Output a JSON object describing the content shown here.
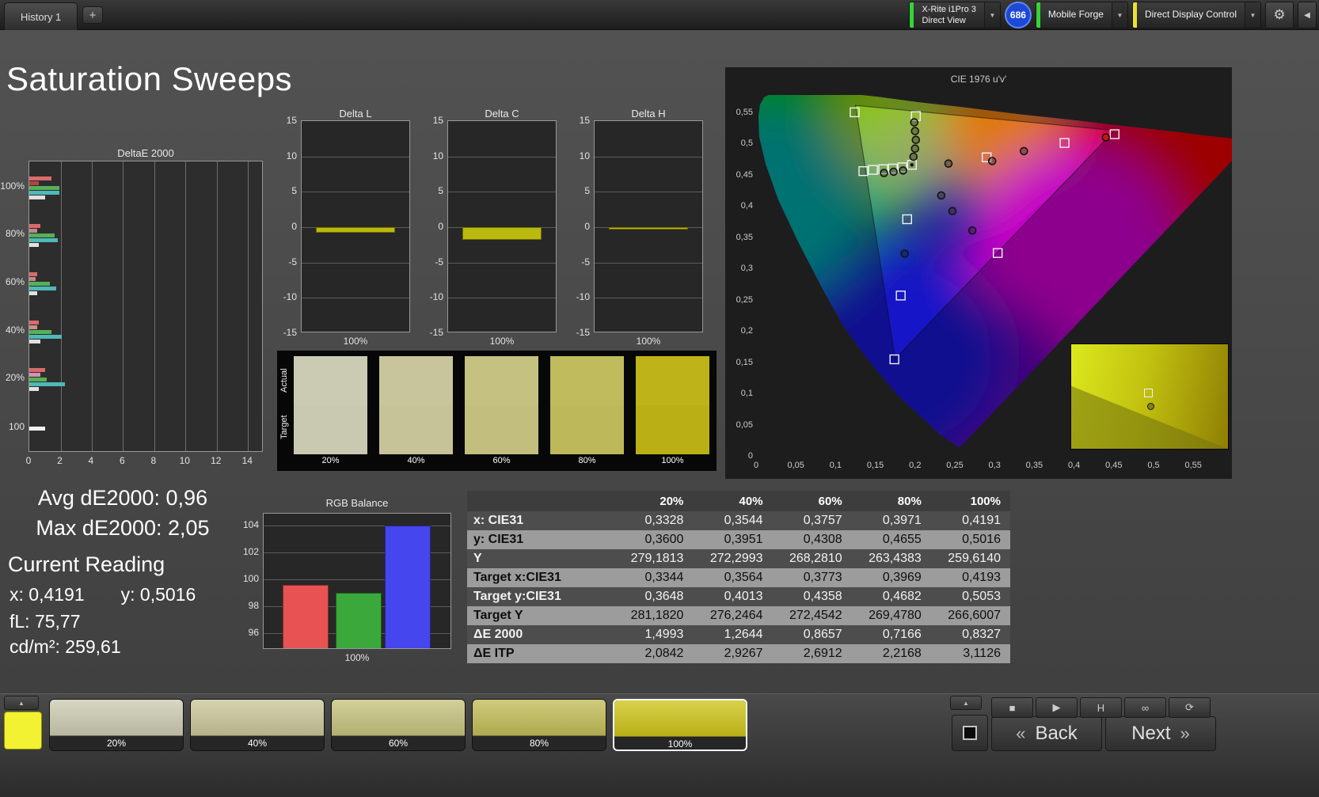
{
  "page_title": "Saturation Sweeps",
  "icons": {
    "gear": "⚙",
    "collapse": "◀",
    "chevron": "▼",
    "up": "▲",
    "back_chevron": "«",
    "next_chevron": "»"
  },
  "top_bar": {
    "history_tab": "History 1",
    "add_tab": "+",
    "meter": {
      "line1": "X-Rite i1Pro 3",
      "line2": "Direct View",
      "accent": "#35d435"
    },
    "badge": "686",
    "badge_color": "#1d49d8",
    "source": {
      "label": "Mobile Forge",
      "accent": "#35d435"
    },
    "display_control": {
      "label": "Direct Display Control",
      "accent": "#e8e136"
    }
  },
  "charts": {
    "deltae2000": {
      "title": "DeltaE 2000",
      "x_ticks": [
        "0",
        "2",
        "4",
        "6",
        "8",
        "10",
        "12",
        "14"
      ],
      "x_max": 15,
      "groups": [
        {
          "label": "100%",
          "bars": [
            {
              "color": "#d96b6b",
              "value": 1.4
            },
            {
              "color": "#b04545",
              "value": 0.6
            },
            {
              "color": "#57b057",
              "value": 1.9
            },
            {
              "color": "#4fb8b8",
              "value": 1.9
            },
            {
              "color": "#e0e0e0",
              "value": 1.0
            }
          ]
        },
        {
          "label": "80%",
          "bars": [
            {
              "color": "#d96b6b",
              "value": 0.7
            },
            {
              "color": "#c08888",
              "value": 0.5
            },
            {
              "color": "#57b057",
              "value": 1.6
            },
            {
              "color": "#4fb8b8",
              "value": 1.8
            },
            {
              "color": "#e0e0e0",
              "value": 0.6
            }
          ]
        },
        {
          "label": "60%",
          "bars": [
            {
              "color": "#d96b6b",
              "value": 0.5
            },
            {
              "color": "#c08888",
              "value": 0.4
            },
            {
              "color": "#57b057",
              "value": 1.3
            },
            {
              "color": "#4fb8b8",
              "value": 1.7
            },
            {
              "color": "#e0e0e0",
              "value": 0.5
            }
          ]
        },
        {
          "label": "40%",
          "bars": [
            {
              "color": "#d96b6b",
              "value": 0.6
            },
            {
              "color": "#c79090",
              "value": 0.5
            },
            {
              "color": "#57b057",
              "value": 1.4
            },
            {
              "color": "#4fb8b8",
              "value": 2.1
            },
            {
              "color": "#e0e0e0",
              "value": 0.7
            }
          ]
        },
        {
          "label": "20%",
          "bars": [
            {
              "color": "#d96b6b",
              "value": 1.0
            },
            {
              "color": "#d98fb0",
              "value": 0.7
            },
            {
              "color": "#57b057",
              "value": 1.1
            },
            {
              "color": "#4fb8b8",
              "value": 2.3
            },
            {
              "color": "#e0e0e0",
              "value": 0.6
            }
          ]
        },
        {
          "label": "100",
          "bars": [
            {
              "color": "#f0f0f0",
              "value": 1.0
            }
          ]
        }
      ]
    },
    "delta_l": {
      "title": "Delta L",
      "value": -0.8,
      "y_ticks": [
        "15",
        "10",
        "5",
        "0",
        "-5",
        "-10",
        "-15"
      ],
      "x_label": "100%",
      "bar_color": "#b9b90f"
    },
    "delta_c": {
      "title": "Delta C",
      "value": -1.8,
      "y_ticks": [
        "15",
        "10",
        "5",
        "0",
        "-5",
        "-10",
        "-15"
      ],
      "x_label": "100%",
      "bar_color": "#b9b90f"
    },
    "delta_h": {
      "title": "Delta H",
      "value": -0.35,
      "y_ticks": [
        "15",
        "10",
        "5",
        "0",
        "-5",
        "-10",
        "-15"
      ],
      "x_label": "100%",
      "bar_color": "#b9b90f"
    },
    "rgb_balance": {
      "title": "RGB Balance",
      "x_label": "100%",
      "y_ticks": [
        "104",
        "102",
        "100",
        "98",
        "96"
      ],
      "top_value": 104,
      "bars": [
        {
          "name": "red",
          "value": 99.6,
          "color": "#e85252"
        },
        {
          "name": "green",
          "value": 99.0,
          "color": "#3aa83a"
        },
        {
          "name": "blue",
          "value": 104.0,
          "color": "#4646ee"
        }
      ]
    }
  },
  "swatch_strip": {
    "row_labels": [
      "Actual",
      "Target"
    ],
    "levels": [
      "20%",
      "40%",
      "60%",
      "80%",
      "100%"
    ],
    "actual_colors": [
      "#cbcab3",
      "#c8c59c",
      "#c4c181",
      "#c0bb5d",
      "#beb419"
    ],
    "target_colors": [
      "#c9c8b0",
      "#c6c399",
      "#c2bf7e",
      "#bdb859",
      "#bab015"
    ]
  },
  "cie": {
    "title": "CIE 1976 u'v'",
    "x_ticks": [
      "0",
      "0,05",
      "0,1",
      "0,15",
      "0,2",
      "0,25",
      "0,3",
      "0,35",
      "0,4",
      "0,45",
      "0,5",
      "0,55"
    ],
    "y_ticks": [
      "0",
      "0,05",
      "0,1",
      "0,15",
      "0,2",
      "0,25",
      "0,3",
      "0,35",
      "0,4",
      "0,45",
      "0,5",
      "0,55"
    ],
    "locus": [
      [
        0.256,
        0.016
      ],
      [
        0.23,
        0.038
      ],
      [
        0.216,
        0.055
      ],
      [
        0.178,
        0.1
      ],
      [
        0.144,
        0.151
      ],
      [
        0.11,
        0.21
      ],
      [
        0.083,
        0.271
      ],
      [
        0.053,
        0.345
      ],
      [
        0.028,
        0.412
      ],
      [
        0.012,
        0.47
      ],
      [
        0.004,
        0.513
      ],
      [
        0.003,
        0.545
      ],
      [
        0.005,
        0.564
      ],
      [
        0.01,
        0.576
      ],
      [
        0.023,
        0.584
      ],
      [
        0.046,
        0.586
      ],
      [
        0.079,
        0.586
      ],
      [
        0.115,
        0.582
      ],
      [
        0.153,
        0.577
      ],
      [
        0.205,
        0.568
      ],
      [
        0.262,
        0.56
      ],
      [
        0.33,
        0.549
      ],
      [
        0.404,
        0.539
      ],
      [
        0.462,
        0.53
      ],
      [
        0.52,
        0.522
      ],
      [
        0.57,
        0.514
      ],
      [
        0.623,
        0.507
      ]
    ],
    "gamut_triangle": [
      [
        0.451,
        0.523
      ],
      [
        0.125,
        0.563
      ],
      [
        0.175,
        0.158
      ]
    ],
    "white_point": [
      0.196,
      0.468
    ],
    "targets": [
      [
        0.124,
        0.552
      ],
      [
        0.201,
        0.546
      ],
      [
        0.135,
        0.458
      ],
      [
        0.147,
        0.46
      ],
      [
        0.16,
        0.461
      ],
      [
        0.172,
        0.462
      ],
      [
        0.184,
        0.464
      ],
      [
        0.196,
        0.468
      ],
      [
        0.29,
        0.48
      ],
      [
        0.388,
        0.503
      ],
      [
        0.451,
        0.517
      ],
      [
        0.19,
        0.381
      ],
      [
        0.304,
        0.327
      ],
      [
        0.182,
        0.259
      ],
      [
        0.174,
        0.157
      ]
    ],
    "measurements": [
      {
        "u": 0.199,
        "v": 0.536
      },
      {
        "u": 0.2,
        "v": 0.522
      },
      {
        "u": 0.201,
        "v": 0.508
      },
      {
        "u": 0.2,
        "v": 0.494
      },
      {
        "u": 0.198,
        "v": 0.481
      },
      {
        "u": 0.161,
        "v": 0.455
      },
      {
        "u": 0.173,
        "v": 0.457
      },
      {
        "u": 0.185,
        "v": 0.459
      },
      {
        "u": 0.242,
        "v": 0.47
      },
      {
        "u": 0.297,
        "v": 0.474
      },
      {
        "u": 0.337,
        "v": 0.49
      },
      {
        "u": 0.44,
        "v": 0.512,
        "fill": "#cc1212"
      },
      {
        "u": 0.233,
        "v": 0.419
      },
      {
        "u": 0.247,
        "v": 0.394
      },
      {
        "u": 0.272,
        "v": 0.363
      },
      {
        "u": 0.187,
        "v": 0.326
      }
    ]
  },
  "readings": {
    "avg": "Avg dE2000: 0,96",
    "max": "Max dE2000: 2,05",
    "current_title": "Current Reading",
    "x": "x: 0,4191",
    "y": "y: 0,5016",
    "fl": "fL: 75,77",
    "cd": "cd/m²: 259,61"
  },
  "table": {
    "header": [
      "",
      "20%",
      "40%",
      "60%",
      "80%",
      "100%"
    ],
    "rows": [
      {
        "label": "x: CIE31",
        "values": [
          "0,3328",
          "0,3544",
          "0,3757",
          "0,3971",
          "0,4191"
        ]
      },
      {
        "label": "y: CIE31",
        "values": [
          "0,3600",
          "0,3951",
          "0,4308",
          "0,4655",
          "0,5016"
        ]
      },
      {
        "label": "Y",
        "values": [
          "279,1813",
          "272,2993",
          "268,2810",
          "263,4383",
          "259,6140"
        ]
      },
      {
        "label": "Target x:CIE31",
        "values": [
          "0,3344",
          "0,3564",
          "0,3773",
          "0,3969",
          "0,4193"
        ]
      },
      {
        "label": "Target y:CIE31",
        "values": [
          "0,3648",
          "0,4013",
          "0,4358",
          "0,4682",
          "0,5053"
        ]
      },
      {
        "label": "Target Y",
        "values": [
          "281,1820",
          "276,2464",
          "272,4542",
          "269,4780",
          "266,6007"
        ]
      },
      {
        "label": "ΔE 2000",
        "values": [
          "1,4993",
          "1,2644",
          "0,8657",
          "0,7166",
          "0,8327"
        ]
      },
      {
        "label": "ΔE ITP",
        "values": [
          "2,0842",
          "2,9267",
          "2,6912",
          "2,2168",
          "3,1126"
        ]
      }
    ]
  },
  "bottom_bar": {
    "current_patch_color": "#f2f233",
    "patches": [
      {
        "label": "20%",
        "color": "#cdccb2",
        "selected": false
      },
      {
        "label": "40%",
        "color": "#cac79a",
        "selected": false
      },
      {
        "label": "60%",
        "color": "#c6c37e",
        "selected": false
      },
      {
        "label": "80%",
        "color": "#c2bd58",
        "selected": false
      },
      {
        "label": "100%",
        "color": "#cdc419",
        "selected": true
      }
    ],
    "transport": [
      {
        "name": "stop-button",
        "glyph": "■"
      },
      {
        "name": "play-button",
        "glyph": "▶"
      },
      {
        "name": "hold-button",
        "glyph": "H"
      },
      {
        "name": "continuous-button",
        "glyph": "∞"
      },
      {
        "name": "loop-button",
        "glyph": "⟳"
      }
    ],
    "back": "Back",
    "next": "Next"
  }
}
